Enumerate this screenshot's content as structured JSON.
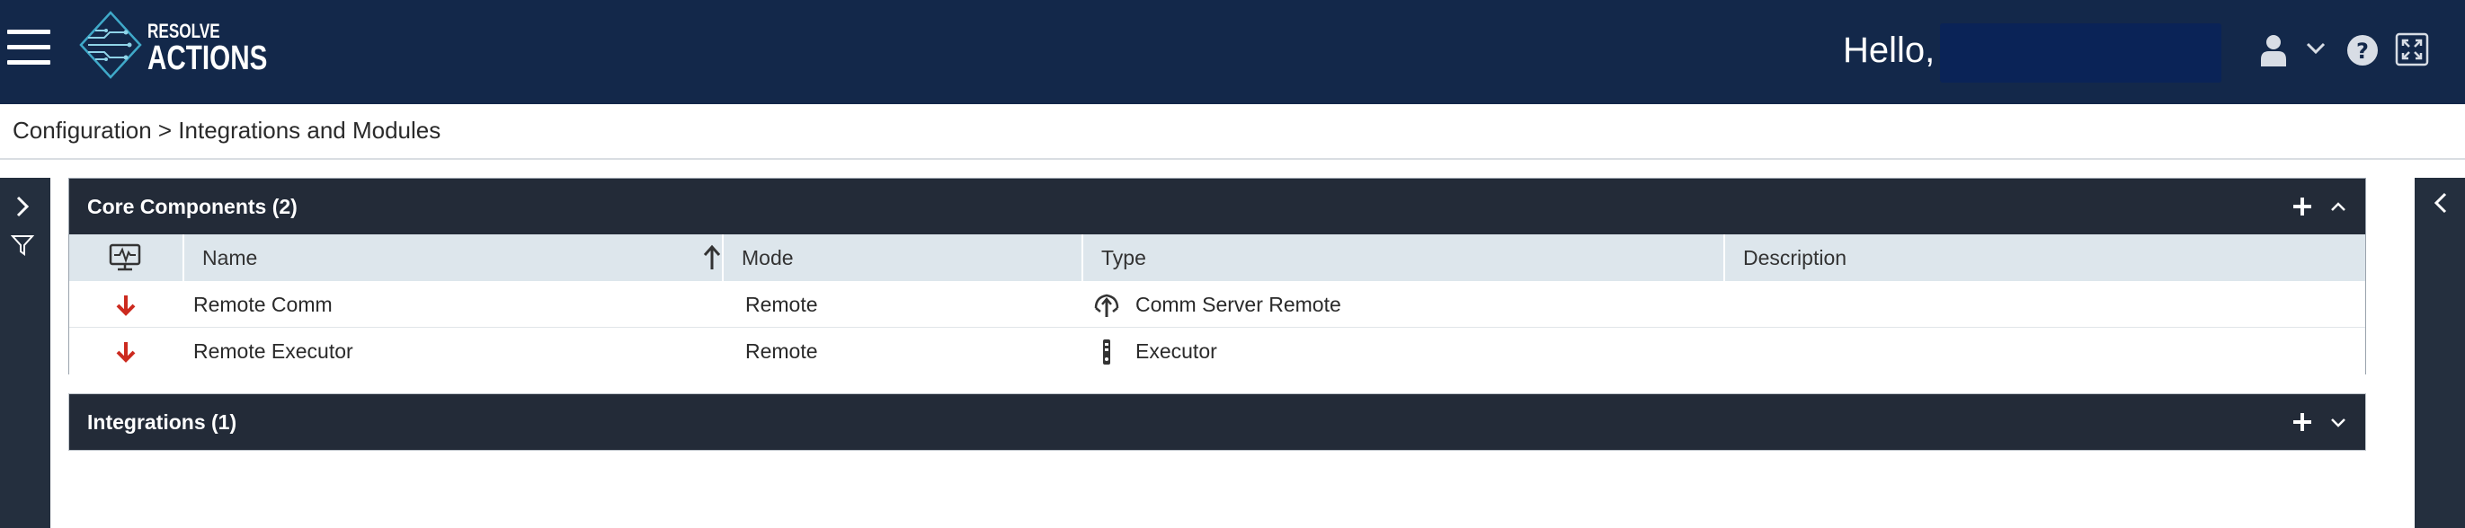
{
  "app": {
    "logo_top": "RESOLVE",
    "logo_bottom": "ACTIONS",
    "greeting": "Hello,"
  },
  "breadcrumb": {
    "text": "Configuration > Integrations and Modules"
  },
  "panels": {
    "core": {
      "title": "Core Components (2)",
      "columns": {
        "name": "Name",
        "mode": "Mode",
        "type": "Type",
        "description": "Description"
      },
      "rows": [
        {
          "name": "Remote Comm",
          "mode": "Remote",
          "type": "Comm Server Remote",
          "description": "",
          "status_icon": "arrow-down-icon",
          "type_icon": "comm-server-icon"
        },
        {
          "name": "Remote Executor",
          "mode": "Remote",
          "type": "Executor",
          "description": "",
          "status_icon": "arrow-down-icon",
          "type_icon": "executor-icon"
        }
      ],
      "sort": "Name ascending"
    },
    "integrations": {
      "title": "Integrations (1)"
    }
  },
  "colors": {
    "header_bg": "#13284a",
    "panel_header_bg": "#232b38",
    "grid_header_bg": "#dde6ec",
    "status_down": "#cc2a1f",
    "rail_bg": "#242f3e"
  }
}
